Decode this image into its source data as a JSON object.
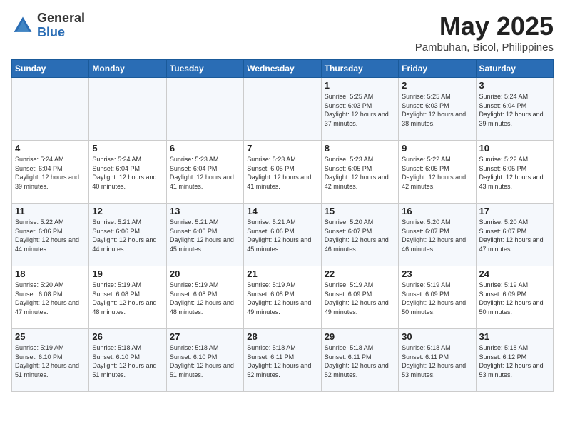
{
  "header": {
    "logo_line1": "General",
    "logo_line2": "Blue",
    "month_title": "May 2025",
    "location": "Pambuhan, Bicol, Philippines"
  },
  "days_of_week": [
    "Sunday",
    "Monday",
    "Tuesday",
    "Wednesday",
    "Thursday",
    "Friday",
    "Saturday"
  ],
  "weeks": [
    [
      {
        "day": "",
        "info": ""
      },
      {
        "day": "",
        "info": ""
      },
      {
        "day": "",
        "info": ""
      },
      {
        "day": "",
        "info": ""
      },
      {
        "day": "1",
        "info": "Sunrise: 5:25 AM\nSunset: 6:03 PM\nDaylight: 12 hours\nand 37 minutes."
      },
      {
        "day": "2",
        "info": "Sunrise: 5:25 AM\nSunset: 6:03 PM\nDaylight: 12 hours\nand 38 minutes."
      },
      {
        "day": "3",
        "info": "Sunrise: 5:24 AM\nSunset: 6:04 PM\nDaylight: 12 hours\nand 39 minutes."
      }
    ],
    [
      {
        "day": "4",
        "info": "Sunrise: 5:24 AM\nSunset: 6:04 PM\nDaylight: 12 hours\nand 39 minutes."
      },
      {
        "day": "5",
        "info": "Sunrise: 5:24 AM\nSunset: 6:04 PM\nDaylight: 12 hours\nand 40 minutes."
      },
      {
        "day": "6",
        "info": "Sunrise: 5:23 AM\nSunset: 6:04 PM\nDaylight: 12 hours\nand 41 minutes."
      },
      {
        "day": "7",
        "info": "Sunrise: 5:23 AM\nSunset: 6:05 PM\nDaylight: 12 hours\nand 41 minutes."
      },
      {
        "day": "8",
        "info": "Sunrise: 5:23 AM\nSunset: 6:05 PM\nDaylight: 12 hours\nand 42 minutes."
      },
      {
        "day": "9",
        "info": "Sunrise: 5:22 AM\nSunset: 6:05 PM\nDaylight: 12 hours\nand 42 minutes."
      },
      {
        "day": "10",
        "info": "Sunrise: 5:22 AM\nSunset: 6:05 PM\nDaylight: 12 hours\nand 43 minutes."
      }
    ],
    [
      {
        "day": "11",
        "info": "Sunrise: 5:22 AM\nSunset: 6:06 PM\nDaylight: 12 hours\nand 44 minutes."
      },
      {
        "day": "12",
        "info": "Sunrise: 5:21 AM\nSunset: 6:06 PM\nDaylight: 12 hours\nand 44 minutes."
      },
      {
        "day": "13",
        "info": "Sunrise: 5:21 AM\nSunset: 6:06 PM\nDaylight: 12 hours\nand 45 minutes."
      },
      {
        "day": "14",
        "info": "Sunrise: 5:21 AM\nSunset: 6:06 PM\nDaylight: 12 hours\nand 45 minutes."
      },
      {
        "day": "15",
        "info": "Sunrise: 5:20 AM\nSunset: 6:07 PM\nDaylight: 12 hours\nand 46 minutes."
      },
      {
        "day": "16",
        "info": "Sunrise: 5:20 AM\nSunset: 6:07 PM\nDaylight: 12 hours\nand 46 minutes."
      },
      {
        "day": "17",
        "info": "Sunrise: 5:20 AM\nSunset: 6:07 PM\nDaylight: 12 hours\nand 47 minutes."
      }
    ],
    [
      {
        "day": "18",
        "info": "Sunrise: 5:20 AM\nSunset: 6:08 PM\nDaylight: 12 hours\nand 47 minutes."
      },
      {
        "day": "19",
        "info": "Sunrise: 5:19 AM\nSunset: 6:08 PM\nDaylight: 12 hours\nand 48 minutes."
      },
      {
        "day": "20",
        "info": "Sunrise: 5:19 AM\nSunset: 6:08 PM\nDaylight: 12 hours\nand 48 minutes."
      },
      {
        "day": "21",
        "info": "Sunrise: 5:19 AM\nSunset: 6:08 PM\nDaylight: 12 hours\nand 49 minutes."
      },
      {
        "day": "22",
        "info": "Sunrise: 5:19 AM\nSunset: 6:09 PM\nDaylight: 12 hours\nand 49 minutes."
      },
      {
        "day": "23",
        "info": "Sunrise: 5:19 AM\nSunset: 6:09 PM\nDaylight: 12 hours\nand 50 minutes."
      },
      {
        "day": "24",
        "info": "Sunrise: 5:19 AM\nSunset: 6:09 PM\nDaylight: 12 hours\nand 50 minutes."
      }
    ],
    [
      {
        "day": "25",
        "info": "Sunrise: 5:19 AM\nSunset: 6:10 PM\nDaylight: 12 hours\nand 51 minutes."
      },
      {
        "day": "26",
        "info": "Sunrise: 5:18 AM\nSunset: 6:10 PM\nDaylight: 12 hours\nand 51 minutes."
      },
      {
        "day": "27",
        "info": "Sunrise: 5:18 AM\nSunset: 6:10 PM\nDaylight: 12 hours\nand 51 minutes."
      },
      {
        "day": "28",
        "info": "Sunrise: 5:18 AM\nSunset: 6:11 PM\nDaylight: 12 hours\nand 52 minutes."
      },
      {
        "day": "29",
        "info": "Sunrise: 5:18 AM\nSunset: 6:11 PM\nDaylight: 12 hours\nand 52 minutes."
      },
      {
        "day": "30",
        "info": "Sunrise: 5:18 AM\nSunset: 6:11 PM\nDaylight: 12 hours\nand 53 minutes."
      },
      {
        "day": "31",
        "info": "Sunrise: 5:18 AM\nSunset: 6:12 PM\nDaylight: 12 hours\nand 53 minutes."
      }
    ]
  ]
}
